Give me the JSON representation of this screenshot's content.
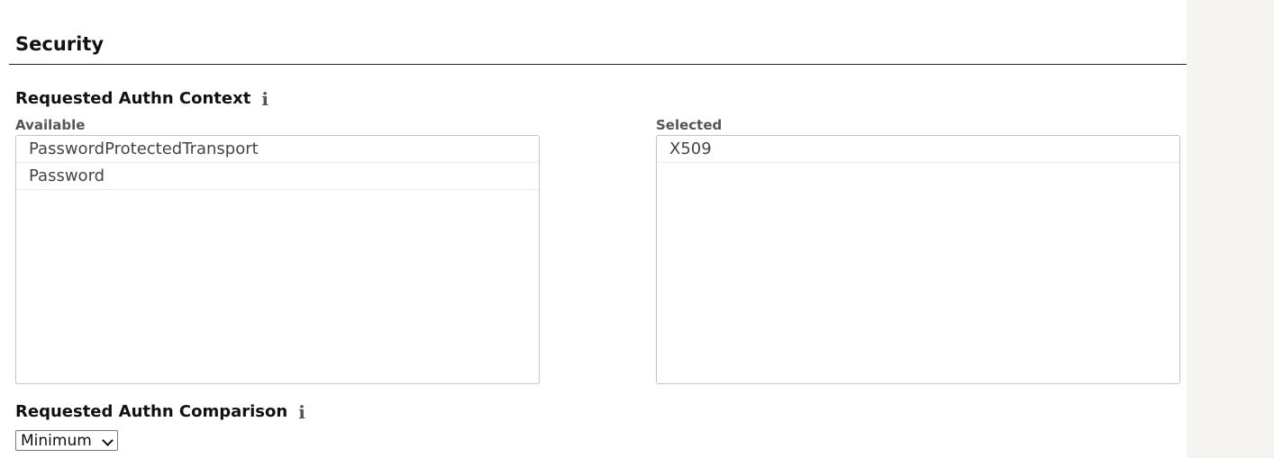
{
  "section": {
    "title": "Security"
  },
  "authn_context": {
    "label": "Requested Authn Context",
    "info_icon": "info-icon",
    "available_label": "Available",
    "selected_label": "Selected",
    "available": [
      "PasswordProtectedTransport",
      "Password"
    ],
    "selected": [
      "X509"
    ]
  },
  "authn_comparison": {
    "label": "Requested Authn Comparison",
    "info_icon": "info-icon",
    "value": "Minimum"
  }
}
